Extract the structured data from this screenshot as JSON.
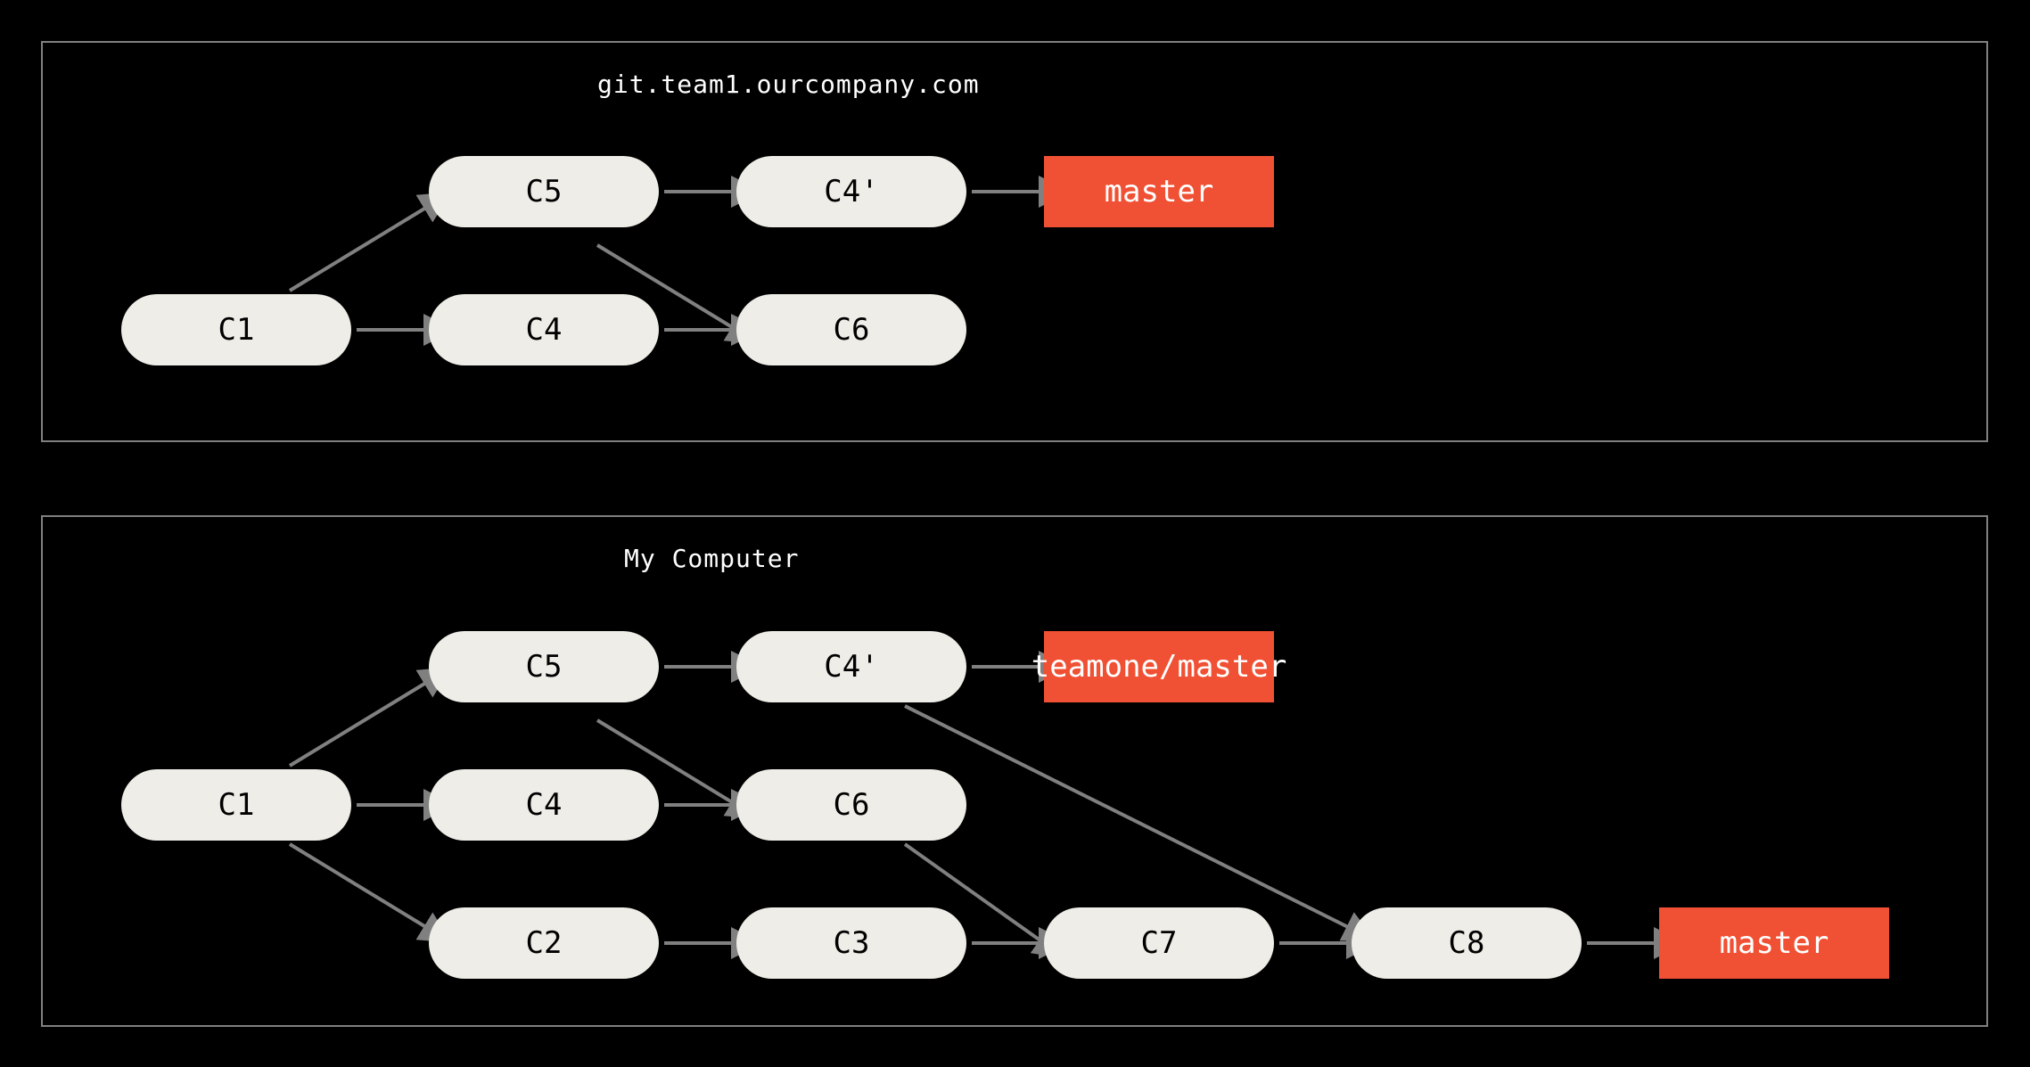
{
  "panels": {
    "remote": {
      "title": "git.team1.ourcompany.com"
    },
    "local": {
      "title": "My Computer"
    }
  },
  "commits": {
    "remote": {
      "c1": "C1",
      "c4": "C4",
      "c5": "C5",
      "c6": "C6",
      "c4p": "C4'"
    },
    "local": {
      "c1": "C1",
      "c2": "C2",
      "c3": "C3",
      "c4": "C4",
      "c5": "C5",
      "c6": "C6",
      "c7": "C7",
      "c8": "C8",
      "c4p": "C4'"
    }
  },
  "branches": {
    "remote": {
      "master": "master"
    },
    "local": {
      "teamone_master": "teamone/master",
      "master": "master"
    }
  },
  "colors": {
    "background": "#000000",
    "panel_border": "#808080",
    "commit_bg": "#eeede7",
    "branch_bg": "#f05033",
    "edge": "#808080",
    "text_dark": "#000000",
    "text_light": "#ffffff"
  },
  "chart_data": {
    "type": "diagram",
    "description": "Git commit graph showing remote server state and local computer state after a fetch, illustrating rebase of commits.",
    "panels": [
      {
        "id": "remote",
        "title": "git.team1.ourcompany.com",
        "nodes": [
          {
            "id": "C1",
            "type": "commit"
          },
          {
            "id": "C4",
            "type": "commit"
          },
          {
            "id": "C5",
            "type": "commit"
          },
          {
            "id": "C6",
            "type": "commit"
          },
          {
            "id": "C4'",
            "type": "commit"
          },
          {
            "id": "master",
            "type": "branch",
            "points_to": "C4'"
          }
        ],
        "edges": [
          {
            "from": "C5",
            "to": "C1"
          },
          {
            "from": "C4",
            "to": "C1"
          },
          {
            "from": "C6",
            "to": "C4"
          },
          {
            "from": "C6",
            "to": "C5"
          },
          {
            "from": "C4'",
            "to": "C5"
          },
          {
            "from": "master",
            "to": "C4'"
          }
        ]
      },
      {
        "id": "local",
        "title": "My Computer",
        "nodes": [
          {
            "id": "C1",
            "type": "commit"
          },
          {
            "id": "C2",
            "type": "commit"
          },
          {
            "id": "C3",
            "type": "commit"
          },
          {
            "id": "C4",
            "type": "commit"
          },
          {
            "id": "C5",
            "type": "commit"
          },
          {
            "id": "C6",
            "type": "commit"
          },
          {
            "id": "C7",
            "type": "commit"
          },
          {
            "id": "C8",
            "type": "commit"
          },
          {
            "id": "C4'",
            "type": "commit"
          },
          {
            "id": "teamone/master",
            "type": "branch",
            "points_to": "C4'"
          },
          {
            "id": "master",
            "type": "branch",
            "points_to": "C8"
          }
        ],
        "edges": [
          {
            "from": "C5",
            "to": "C1"
          },
          {
            "from": "C4",
            "to": "C1"
          },
          {
            "from": "C2",
            "to": "C1"
          },
          {
            "from": "C6",
            "to": "C4"
          },
          {
            "from": "C6",
            "to": "C5"
          },
          {
            "from": "C3",
            "to": "C2"
          },
          {
            "from": "C7",
            "to": "C3"
          },
          {
            "from": "C7",
            "to": "C6"
          },
          {
            "from": "C4'",
            "to": "C5"
          },
          {
            "from": "C8",
            "to": "C7"
          },
          {
            "from": "C8",
            "to": "C4'"
          },
          {
            "from": "teamone/master",
            "to": "C4'"
          },
          {
            "from": "master",
            "to": "C8"
          }
        ]
      }
    ]
  }
}
